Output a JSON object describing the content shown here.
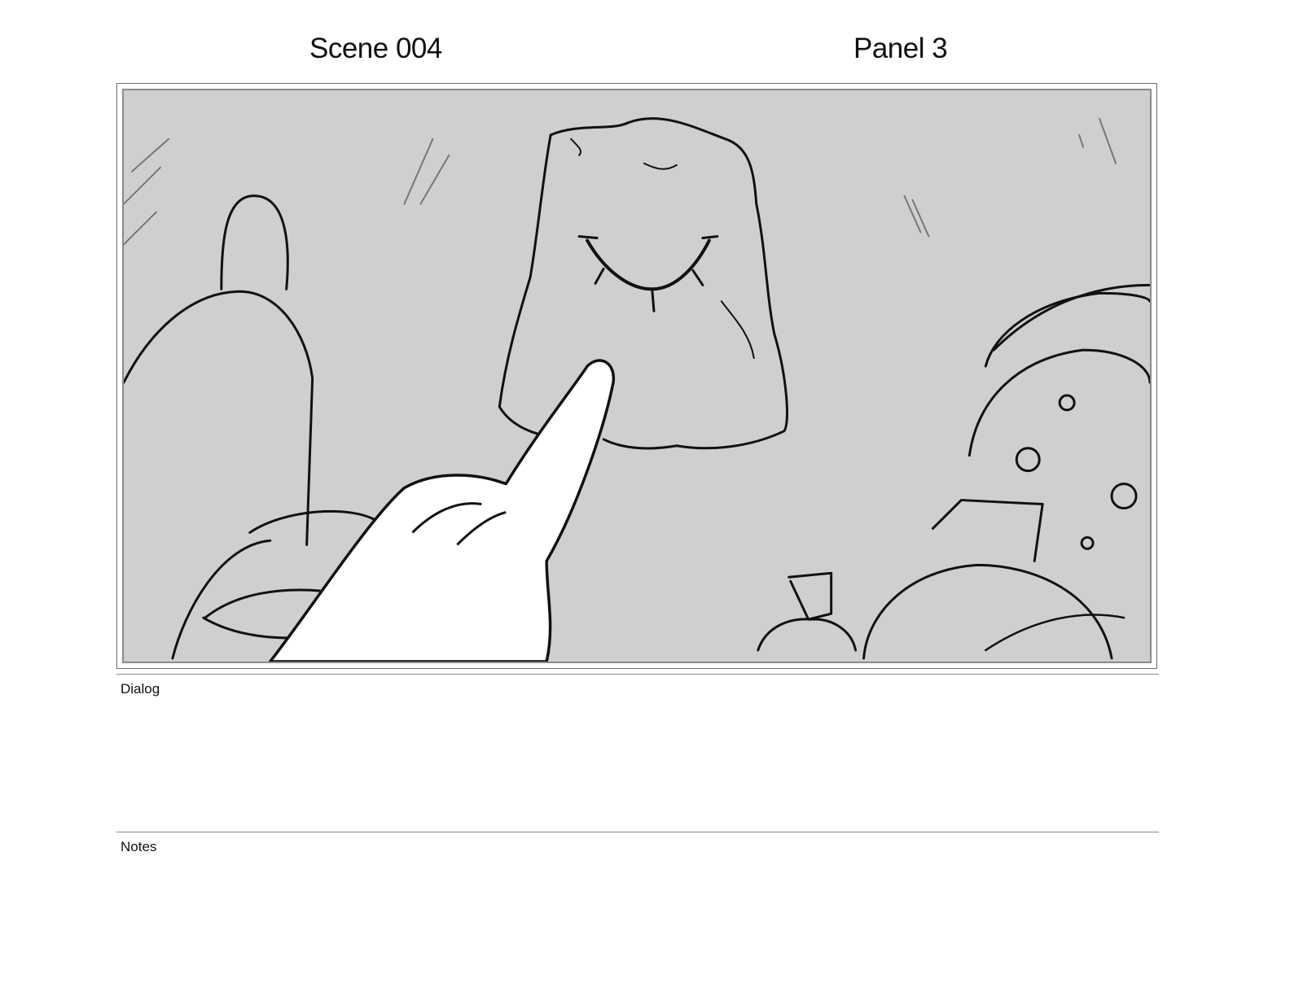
{
  "header": {
    "scene": "Scene 004",
    "panel": "Panel 3"
  },
  "panel_image": {
    "background_color": "#cfcfcf",
    "line_color": "#111111",
    "hand_fill": "#ffffff"
  },
  "sections": {
    "dialog_label": "Dialog",
    "dialog_text": "",
    "notes_label": "Notes",
    "notes_text": ""
  }
}
